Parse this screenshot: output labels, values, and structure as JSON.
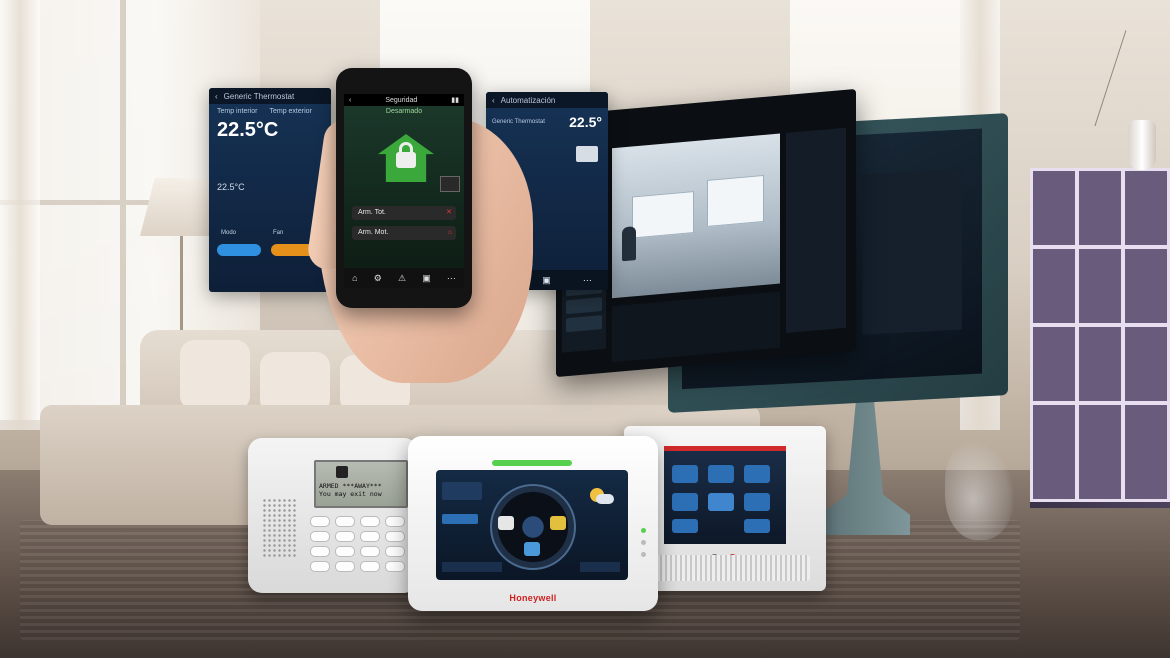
{
  "thermostat_app": {
    "title": "Generic Thermostat",
    "inside_label": "Temp interior",
    "outside_label": "Temp exterior",
    "temperature": "22.5°C",
    "setpoint": "22.5°C",
    "mode_label": "Modo",
    "fan_label": "Fan"
  },
  "phone": {
    "header": "Seguridad",
    "status": "Desarmado",
    "arm_button": "Arm. Tot.",
    "arm_stay_button": "Arm. Mot."
  },
  "automation_app": {
    "title": "Automatización",
    "item": "Generic Thermostat",
    "temperature": "22.5°"
  },
  "keypad": {
    "line1": "ARMED ***AWAY***",
    "line2": "You may exit now"
  },
  "tuxedo": {
    "brand": "Honeywell"
  },
  "colors": {
    "brand_red": "#d02020",
    "armed_green": "#3aa83b",
    "screen_blue": "#142a44"
  },
  "icons": [
    "lock-icon",
    "house-icon",
    "running-man-icon",
    "alert-icon"
  ]
}
